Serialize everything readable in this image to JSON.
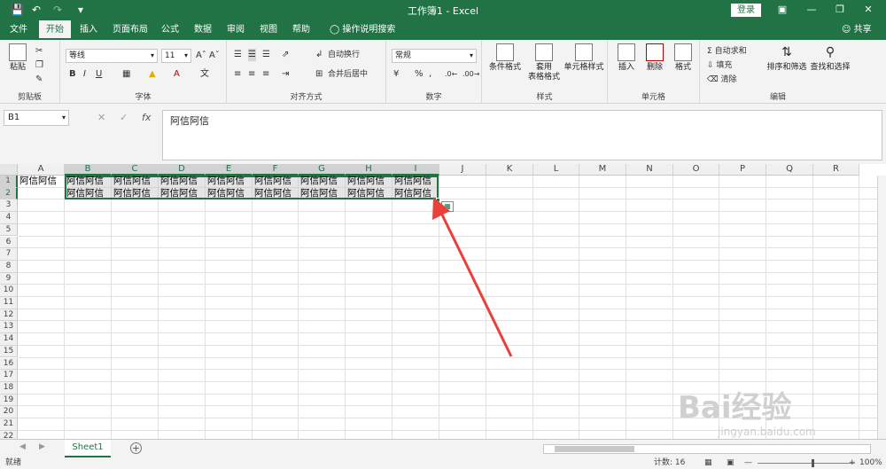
{
  "window": {
    "title": "工作簿1 - Excel",
    "login_label": "登录",
    "quick_access": [
      "save-icon",
      "undo-icon",
      "redo-icon",
      "customize-icon"
    ]
  },
  "tabs": [
    {
      "label": "文件"
    },
    {
      "label": "开始",
      "active": true
    },
    {
      "label": "插入"
    },
    {
      "label": "页面布局"
    },
    {
      "label": "公式"
    },
    {
      "label": "数据"
    },
    {
      "label": "审阅"
    },
    {
      "label": "视图"
    },
    {
      "label": "帮助"
    }
  ],
  "tell_me": "操作说明搜索",
  "share": "共享",
  "ribbon": {
    "clipboard": {
      "label": "剪贴板",
      "paste": "粘贴"
    },
    "font": {
      "label": "字体",
      "name": "等线",
      "size": "11",
      "bold": "B",
      "italic": "I",
      "underline": "U"
    },
    "alignment": {
      "label": "对齐方式",
      "wrap": "自动换行",
      "merge": "合并后居中"
    },
    "number": {
      "label": "数字",
      "format": "常规",
      "percent": "%"
    },
    "styles": {
      "label": "样式",
      "conditional": "条件格式",
      "table_format_1": "套用",
      "table_format_2": "表格格式",
      "cell_styles": "单元格样式"
    },
    "cells": {
      "label": "单元格",
      "insert": "插入",
      "delete": "删除",
      "format": "格式"
    },
    "editing": {
      "label": "编辑",
      "autosum": "自动求和",
      "fill": "填充",
      "clear": "清除",
      "sort": "排序和筛选",
      "find": "查找和选择"
    }
  },
  "formula_bar": {
    "name_box": "B1",
    "fx": "fx",
    "formula": "阿信阿信"
  },
  "columns": [
    "A",
    "B",
    "C",
    "D",
    "E",
    "F",
    "G",
    "H",
    "I",
    "J",
    "K",
    "L",
    "M",
    "N",
    "O",
    "P",
    "Q",
    "R"
  ],
  "selected_columns": [
    "B",
    "C",
    "D",
    "E",
    "F",
    "G",
    "H",
    "I"
  ],
  "rows": [
    "1",
    "2",
    "3",
    "4",
    "5",
    "6",
    "7",
    "8",
    "9",
    "10",
    "11",
    "12",
    "13",
    "14",
    "15",
    "16",
    "17",
    "18",
    "19",
    "20",
    "21",
    "22"
  ],
  "cells": {
    "A1": "阿信阿信",
    "B1": "阿信阿信",
    "C1": "阿信阿信",
    "D1": "阿信阿信",
    "E1": "阿信阿信",
    "F1": "阿信阿信",
    "G1": "阿信阿信",
    "H1": "阿信阿信",
    "I1": "阿信阿信",
    "B2": "阿信阿信",
    "C2": "阿信阿信",
    "D2": "阿信阿信",
    "E2": "阿信阿信",
    "F2": "阿信阿信",
    "G2": "阿信阿信",
    "H2": "阿信阿信",
    "I2": "阿信阿信"
  },
  "sheet": {
    "name": "Sheet1"
  },
  "status": {
    "ready": "就绪",
    "count": "计数: 16",
    "zoom": "100%"
  },
  "watermark": {
    "brand": "Bai经验",
    "url": "jingyan.baidu.com"
  },
  "colors": {
    "accent": "#217346",
    "arrow": "#e8403b"
  }
}
